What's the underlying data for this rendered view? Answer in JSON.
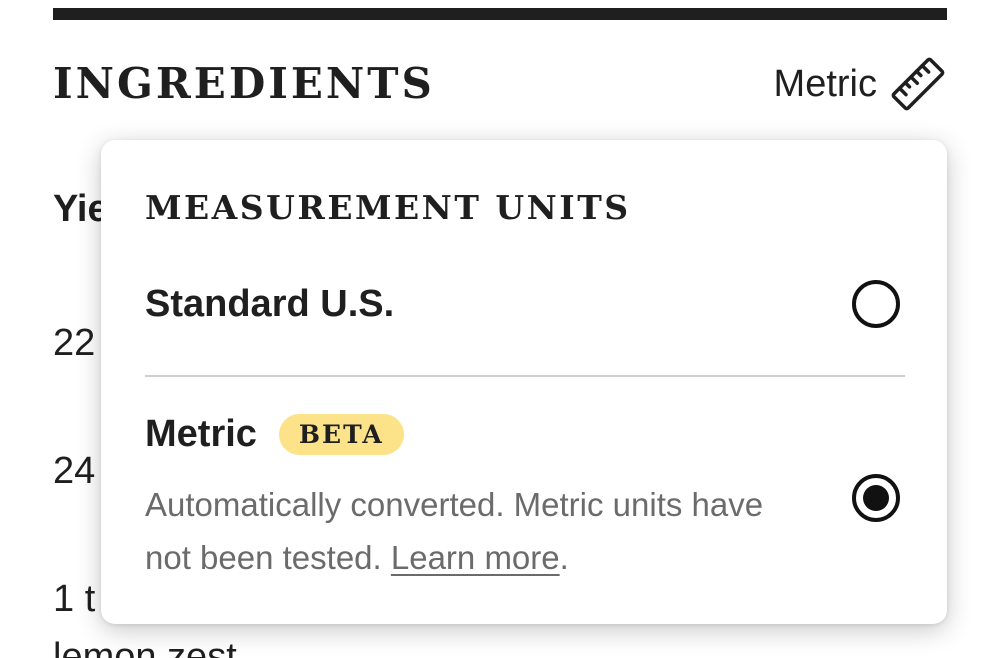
{
  "header": {
    "title": "INGREDIENTS",
    "units_toggle_label": "Metric",
    "units_toggle_icon": "ruler-icon"
  },
  "background": {
    "yield_text": "Yie",
    "rows": [
      "22",
      "24",
      "1 t",
      "lemon zest"
    ]
  },
  "popover": {
    "title": "MEASUREMENT UNITS",
    "options": [
      {
        "label": "Standard U.S.",
        "selected": false
      },
      {
        "label": "Metric",
        "badge": "BETA",
        "description_text": "Automatically converted. Metric units have not been tested.",
        "link_text": "Learn more",
        "description_end": ".",
        "selected": true
      }
    ]
  },
  "colors": {
    "text": "#1f1f1f",
    "muted_text": "#6b6b6b",
    "badge_background": "#fce38a",
    "divider": "#cfcfcf"
  }
}
